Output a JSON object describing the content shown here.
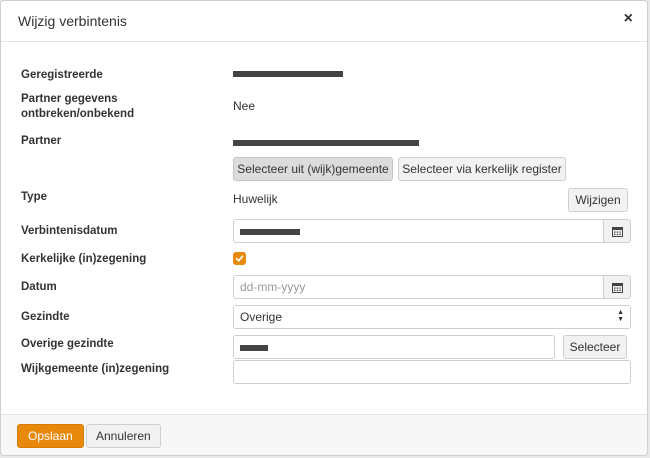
{
  "dialog": {
    "title": "Wijzig verbintenis",
    "close_symbol": "×"
  },
  "fields": {
    "geregistreerde": {
      "label": "Geregistreerde"
    },
    "partner_missing": {
      "label": "Partner gegevens ontbreken/onbekend",
      "value": "Nee"
    },
    "partner": {
      "label": "Partner",
      "btn_wijkgemeente": "Selecteer uit (wijk)gemeente",
      "btn_register": "Selecteer via kerkelijk register"
    },
    "type": {
      "label": "Type",
      "value": "Huwelijk",
      "btn_change": "Wijzigen"
    },
    "verbintenisdatum": {
      "label": "Verbintenisdatum"
    },
    "kerkelijke_inzegening": {
      "label": "Kerkelijke (in)zegening",
      "checked": true
    },
    "datum": {
      "label": "Datum",
      "placeholder": "dd-mm-yyyy"
    },
    "gezindte": {
      "label": "Gezindte",
      "selected": "Overige"
    },
    "overige_gezindte": {
      "label": "Overige gezindte",
      "btn_select": "Selecteer"
    },
    "wijkgemeente_inzegening": {
      "label": "Wijkgemeente (in)zegening",
      "value": ""
    }
  },
  "footer": {
    "save_label": "Opslaan",
    "cancel_label": "Annuleren"
  },
  "colors": {
    "accent": "#e8890c"
  },
  "icons": {
    "calendar": "calendar-icon",
    "close": "close-icon",
    "check": "check-icon",
    "sort": "sort-arrows-icon"
  }
}
